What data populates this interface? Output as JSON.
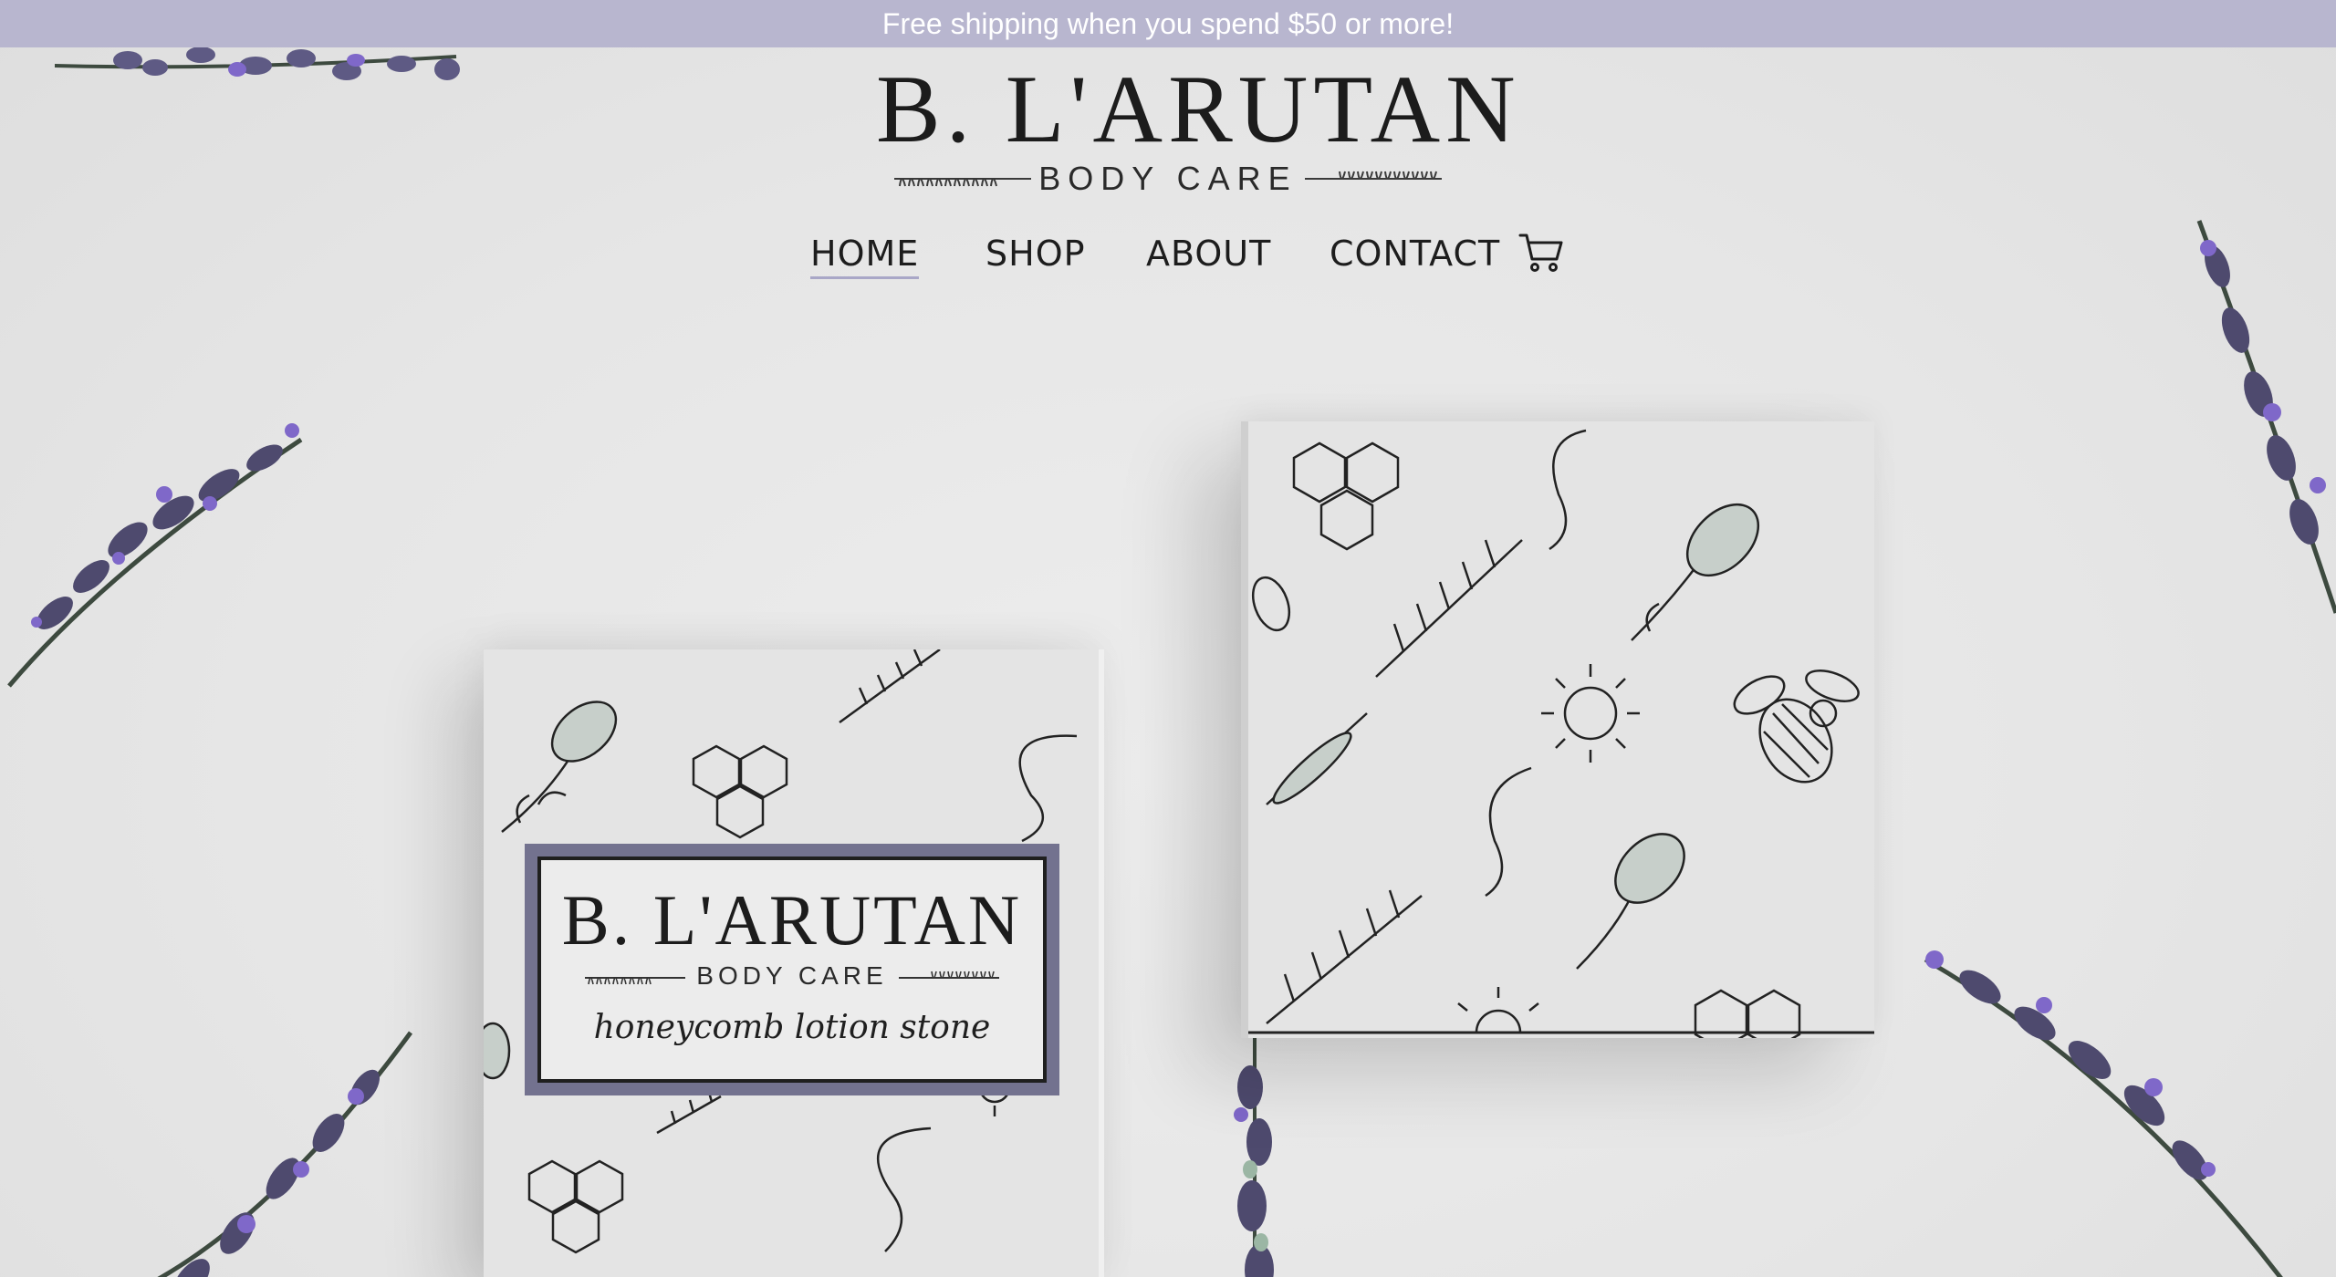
{
  "announcement": {
    "text": "Free shipping when you spend $50 or more!"
  },
  "brand": {
    "name": "B. L'ARUTAN",
    "tagline": "BODY CARE"
  },
  "nav": {
    "items": [
      {
        "label": "HOME",
        "active": true
      },
      {
        "label": "SHOP",
        "active": false
      },
      {
        "label": "ABOUT",
        "active": false
      },
      {
        "label": "CONTACT",
        "active": false
      }
    ],
    "cart_icon": "shopping-cart-icon"
  },
  "hero": {
    "product_label": {
      "brand": "B. L'ARUTAN",
      "tagline": "BODY CARE",
      "product": "honeycomb lotion stone"
    },
    "decor_icons": [
      "lavender-sprig-icon",
      "honeycomb-icon",
      "bee-icon",
      "sun-icon",
      "fern-icon"
    ]
  },
  "colors": {
    "announcement_bg": "#b8b6cf",
    "label_frame": "#73728f",
    "nav_active_underline": "#a9a7c7",
    "lavender": "#7f68c9"
  }
}
